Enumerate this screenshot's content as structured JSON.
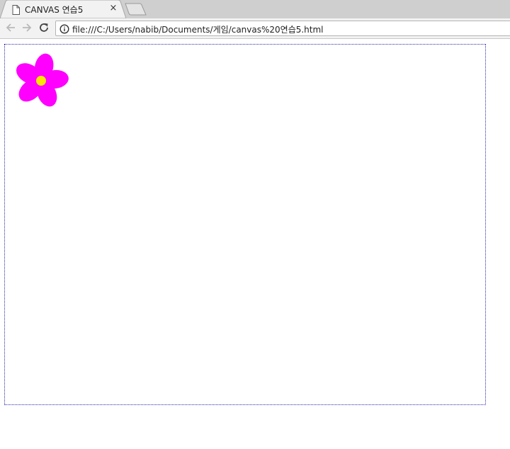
{
  "tab": {
    "title": "CANVAS 연습5",
    "close_glyph": "×",
    "favicon": "document-icon"
  },
  "toolbar": {
    "back_icon": "arrow-left-icon",
    "forward_icon": "arrow-right-icon",
    "reload_icon": "reload-icon",
    "info_icon": "info-icon",
    "url": "file:///C:/Users/nabib/Documents/게임/canvas%20연습5.html"
  },
  "canvas": {
    "border_color": "#2a2aa8",
    "flower": {
      "petal_color": "#ff00ff",
      "center_color": "#ffe600",
      "petal_count": 5
    }
  }
}
